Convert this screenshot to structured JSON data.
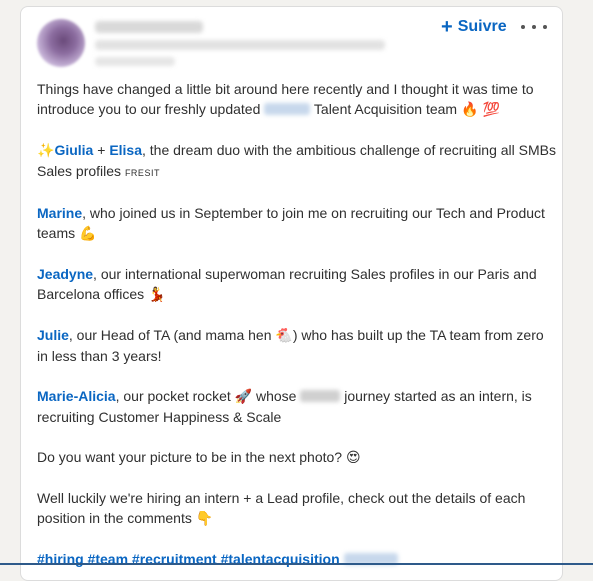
{
  "header": {
    "follow_label": "Suivre",
    "follow_plus": "+"
  },
  "post": {
    "intro_part1": "Things have changed a little bit around here recently and I thought it was time to introduce you to our freshly updated",
    "intro_part2": "Talent Acquisition team",
    "intro_emojis": "🔥 💯",
    "duo_sparkle": "✨",
    "duo_name1": "Giulia",
    "duo_plus": " + ",
    "duo_name2": "Elisa",
    "duo_text": ", the dream duo with the ambitious challenge of recruiting all SMBs Sales profiles",
    "duo_tag": "FRESIT",
    "marine_name": "Marine",
    "marine_text": ", who joined us in September to join me on recruiting our Tech and Product teams",
    "marine_emoji": "💪",
    "jeadyne_name": "Jeadyne",
    "jeadyne_text": ", our international superwoman recruiting Sales profiles in our Paris and Barcelona offices",
    "jeadyne_emoji": "💃",
    "julie_name": "Julie",
    "julie_text1": ", our Head of TA (and mama hen",
    "julie_emoji": "🐔",
    "julie_text2": ") who has built up the TA team from zero in less than 3 years!",
    "marie_name": "Marie-Alicia",
    "marie_text1": ", our pocket rocket",
    "marie_emoji": "🚀",
    "marie_text2": "whose",
    "marie_text3": "journey started as an intern, is recruiting Customer Happiness & Scale",
    "question_text": "Do you want your picture to be in the next photo?",
    "question_emoji": "😍",
    "hiring_text": "Well luckily we're hiring an intern + a Lead profile, check out the details of each position in the comments",
    "hiring_emoji": "👇",
    "hashtags": "#hiring #team #recruitment #talentacquisition"
  }
}
